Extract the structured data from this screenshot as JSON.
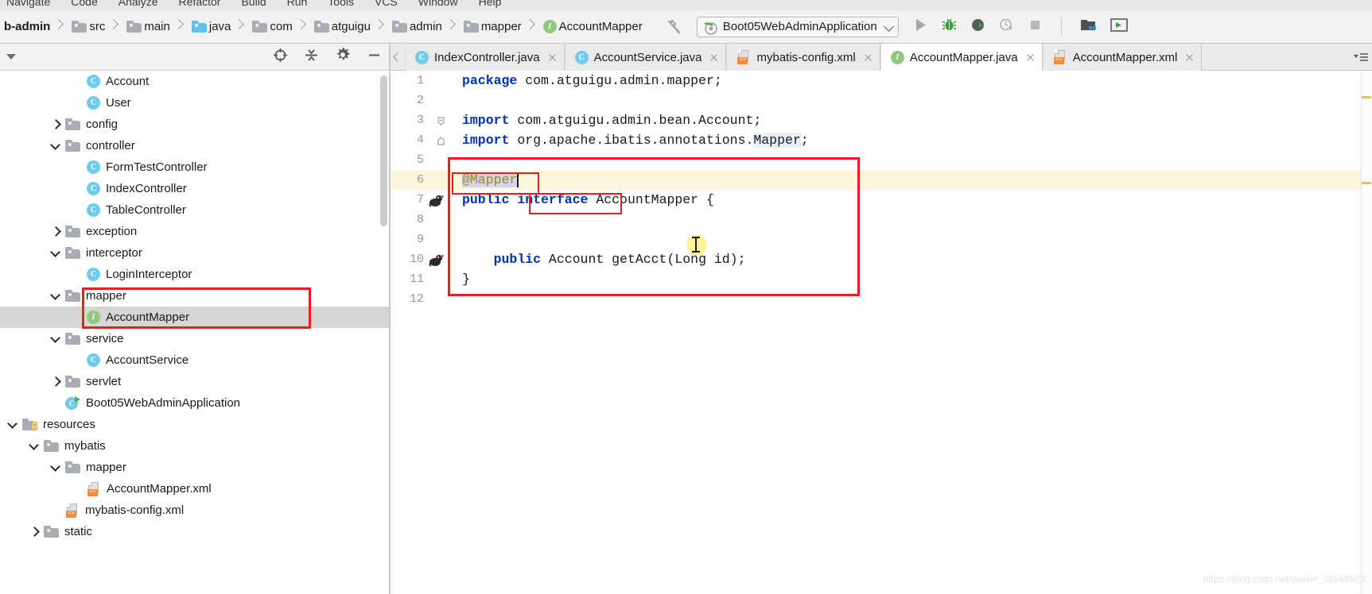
{
  "menu": {
    "items": [
      "Navigate",
      "Code",
      "Analyze",
      "Refactor",
      "Build",
      "Run",
      "Tools",
      "VCS",
      "Window",
      "Help"
    ]
  },
  "breadcrumbs": [
    {
      "label": "b-admin",
      "icon": "none",
      "bold": true
    },
    {
      "label": "src",
      "icon": "folder-gray"
    },
    {
      "label": "main",
      "icon": "folder-gray"
    },
    {
      "label": "java",
      "icon": "folder-blue"
    },
    {
      "label": "com",
      "icon": "folder-gray"
    },
    {
      "label": "atguigu",
      "icon": "folder-gray"
    },
    {
      "label": "admin",
      "icon": "folder-gray"
    },
    {
      "label": "mapper",
      "icon": "folder-gray"
    },
    {
      "label": "AccountMapper",
      "icon": "interface-badge"
    }
  ],
  "toolbar": {
    "build_icon": "hammer-icon",
    "run_config": "Boot05WebAdminApplication",
    "run_config_icon": "spring-boot-icon",
    "dropdown_icon": "chevron-down-icon",
    "actions": [
      {
        "name": "run-button",
        "icon": "play-icon"
      },
      {
        "name": "debug-button",
        "icon": "bug-icon"
      },
      {
        "name": "run-with-coverage-button",
        "icon": "coverage-icon"
      },
      {
        "name": "profile-button",
        "icon": "profiler-icon"
      },
      {
        "name": "stop-button",
        "icon": "stop-icon"
      },
      {
        "name": "project-structure-button",
        "icon": "project-structure-icon"
      },
      {
        "name": "open-terminal-button",
        "icon": "terminal-window-icon"
      }
    ]
  },
  "project_panel": {
    "collapse_caret": "caret-down-icon",
    "tools": [
      {
        "name": "scroll-from-source-button",
        "icon": "locate-target-icon"
      },
      {
        "name": "collapse-all-button",
        "icon": "collapse-all-icon"
      },
      {
        "name": "settings-button",
        "icon": "gear-icon"
      },
      {
        "name": "hide-panel-button",
        "icon": "minimize-icon"
      }
    ],
    "tree": [
      {
        "label": "Account",
        "icon": "class-badge",
        "indent": 4,
        "arrow": "none",
        "selected": false
      },
      {
        "label": "User",
        "icon": "class-badge",
        "indent": 4,
        "arrow": "none",
        "selected": false
      },
      {
        "label": "config",
        "icon": "folder-gray",
        "indent": 3,
        "arrow": "right",
        "selected": false
      },
      {
        "label": "controller",
        "icon": "folder-gray",
        "indent": 3,
        "arrow": "down",
        "selected": false
      },
      {
        "label": "FormTestController",
        "icon": "class-badge",
        "indent": 4,
        "arrow": "none",
        "selected": false
      },
      {
        "label": "IndexController",
        "icon": "class-badge",
        "indent": 4,
        "arrow": "none",
        "selected": false
      },
      {
        "label": "TableController",
        "icon": "class-badge",
        "indent": 4,
        "arrow": "none",
        "selected": false
      },
      {
        "label": "exception",
        "icon": "folder-gray",
        "indent": 3,
        "arrow": "right",
        "selected": false
      },
      {
        "label": "interceptor",
        "icon": "folder-gray",
        "indent": 3,
        "arrow": "down",
        "selected": false
      },
      {
        "label": "LoginInterceptor",
        "icon": "class-badge",
        "indent": 4,
        "arrow": "none",
        "selected": false
      },
      {
        "label": "mapper",
        "icon": "folder-gray",
        "indent": 3,
        "arrow": "down",
        "selected": false
      },
      {
        "label": "AccountMapper",
        "icon": "interface-badge",
        "indent": 4,
        "arrow": "none",
        "selected": true
      },
      {
        "label": "service",
        "icon": "folder-gray",
        "indent": 3,
        "arrow": "down",
        "selected": false
      },
      {
        "label": "AccountService",
        "icon": "class-badge",
        "indent": 4,
        "arrow": "none",
        "selected": false
      },
      {
        "label": "servlet",
        "icon": "folder-gray",
        "indent": 3,
        "arrow": "right",
        "selected": false
      },
      {
        "label": "Boot05WebAdminApplication",
        "icon": "spring-boot-icon",
        "indent": 3,
        "arrow": "none",
        "selected": false
      },
      {
        "label": "resources",
        "icon": "resources-folder",
        "indent": 1,
        "arrow": "down",
        "selected": false
      },
      {
        "label": "mybatis",
        "icon": "folder-gray",
        "indent": 2,
        "arrow": "down",
        "selected": false
      },
      {
        "label": "mapper",
        "icon": "folder-gray",
        "indent": 3,
        "arrow": "down",
        "selected": false
      },
      {
        "label": "AccountMapper.xml",
        "icon": "xml-file",
        "indent": 4,
        "arrow": "none",
        "selected": false
      },
      {
        "label": "mybatis-config.xml",
        "icon": "xml-file",
        "indent": 3,
        "arrow": "none",
        "selected": false
      },
      {
        "label": "static",
        "icon": "folder-gray",
        "indent": 2,
        "arrow": "right",
        "selected": false
      }
    ]
  },
  "editor_tabs": {
    "prev_button_icon": "chevron-left-icon",
    "tabs": [
      {
        "label": "IndexController.java",
        "icon": "class-badge",
        "active": false
      },
      {
        "label": "AccountService.java",
        "icon": "class-badge",
        "active": false
      },
      {
        "label": "mybatis-config.xml",
        "icon": "xml-file",
        "active": false
      },
      {
        "label": "AccountMapper.java",
        "icon": "interface-badge",
        "active": true
      },
      {
        "label": "AccountMapper.xml",
        "icon": "xml-file",
        "active": false
      }
    ],
    "overflow_icon": "tab-list-icon"
  },
  "editor": {
    "current_line": 6,
    "lines": [
      {
        "num": 1,
        "gutter": "none",
        "fold": "none"
      },
      {
        "num": 2,
        "gutter": "none",
        "fold": "none"
      },
      {
        "num": 3,
        "gutter": "none",
        "fold": "fold-start"
      },
      {
        "num": 4,
        "gutter": "none",
        "fold": "fold-end"
      },
      {
        "num": 5,
        "gutter": "none",
        "fold": "none"
      },
      {
        "num": 6,
        "gutter": "none",
        "fold": "none"
      },
      {
        "num": 7,
        "gutter": "mybatis",
        "fold": "none"
      },
      {
        "num": 8,
        "gutter": "none",
        "fold": "none"
      },
      {
        "num": 9,
        "gutter": "none",
        "fold": "none"
      },
      {
        "num": 10,
        "gutter": "mybatis",
        "fold": "none"
      },
      {
        "num": 11,
        "gutter": "none",
        "fold": "none"
      },
      {
        "num": 12,
        "gutter": "none",
        "fold": "none"
      }
    ],
    "code": {
      "l1_kw": "package",
      "l1_rest": " com.atguigu.admin.mapper;",
      "l3_kw": "import",
      "l3_rest": " com.atguigu.admin.bean.Account;",
      "l4_kw": "import",
      "l4_a": " org.apache.ibatis.annotations.",
      "l4_type": "Mapper",
      "l4_semi": ";",
      "l6_anno": "@Mapper",
      "l7_kw1": "public",
      "l7_kw2": "interface",
      "l7_name": " AccountMapper {",
      "l10_kw": "public",
      "l10_rest": " Account getAcct(Long id);",
      "l11": "}"
    }
  },
  "annotations": {
    "code_box": "red-highlight-box-code",
    "mapper_word_box": "red-highlight-box-mapper-annotation",
    "interface_word_box": "red-highlight-box-interface-keyword",
    "tree_box": "red-highlight-box-tree-mapper"
  },
  "watermark": "https://blog.csdn.net/weixin_38568503"
}
